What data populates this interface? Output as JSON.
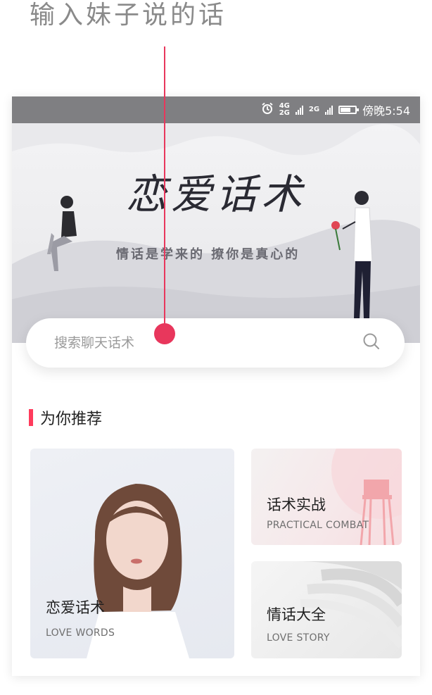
{
  "annotation": {
    "text": "输入妹子说的话"
  },
  "status_bar": {
    "net1": "4G",
    "net2": "2G",
    "time": "傍晚5:54"
  },
  "hero": {
    "title": "恋爱话术",
    "subtitle": "情话是学来的 撩你是真心的"
  },
  "search": {
    "placeholder": "搜索聊天话术"
  },
  "section": {
    "title": "为你推荐"
  },
  "cards": {
    "love": {
      "title": "恋爱话术",
      "subtitle": "LOVE WORDS"
    },
    "practical": {
      "title": "话术实战",
      "subtitle": "PRACTICAL COMBAT"
    },
    "story": {
      "title": "情话大全",
      "subtitle": "LOVE STORY"
    }
  },
  "colors": {
    "accent": "#ff3b5c",
    "annotation": "#e8375c",
    "status_bar": "#7f7f82"
  },
  "icons": [
    "alarm-icon",
    "signal-icon",
    "battery-icon",
    "search-icon"
  ]
}
